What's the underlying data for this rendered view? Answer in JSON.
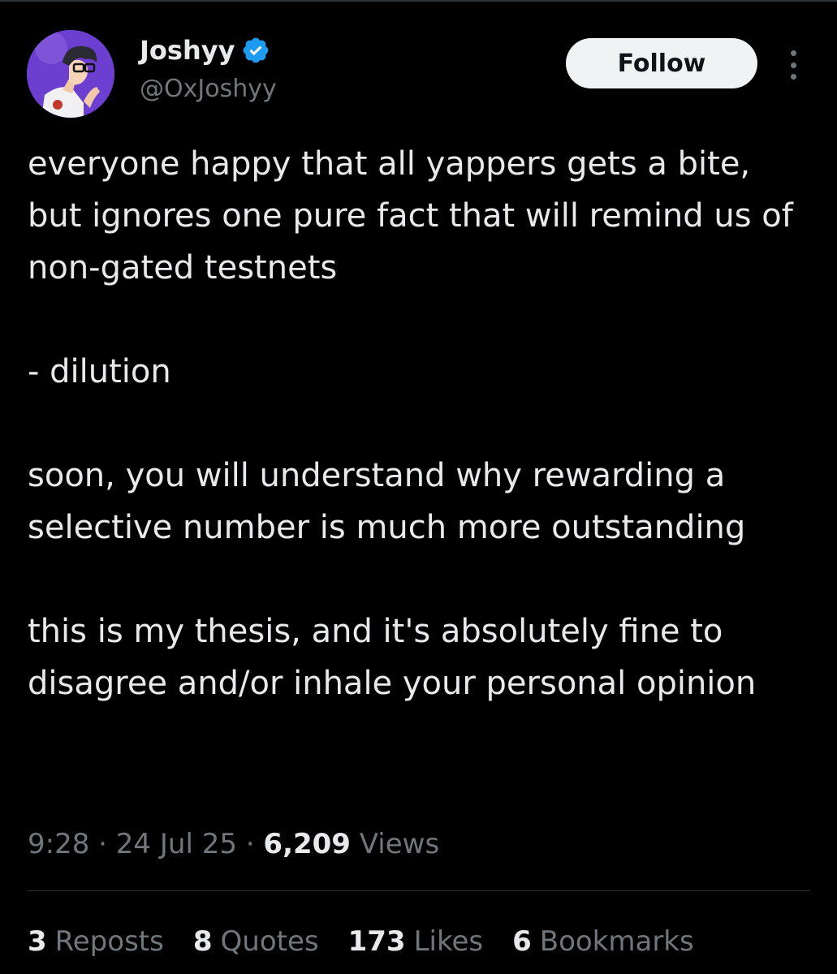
{
  "author": {
    "display_name": "Joshyy",
    "handle": "@OxJoshyy",
    "verified": true,
    "avatar_icon": "anime-avatar",
    "avatar_bg": "#6c3fd0"
  },
  "actions": {
    "follow_label": "Follow",
    "more_icon": "more-vertical-icon"
  },
  "tweet": {
    "paragraphs": [
      "everyone happy that all yappers gets a bite, but ignores one pure fact that will remind us of non-gated testnets",
      "- dilution",
      "soon, you will understand why rewarding a selective number is much more outstanding",
      "this is my thesis, and it's absolutely fine to disagree and/or inhale your personal opinion"
    ]
  },
  "meta": {
    "time": "9:28",
    "date": "24 Jul 25",
    "separator": "·",
    "views_count": "6,209",
    "views_label": "Views"
  },
  "stats": {
    "reposts_count": "3",
    "reposts_label": "Reposts",
    "quotes_count": "8",
    "quotes_label": "Quotes",
    "likes_count": "173",
    "likes_label": "Likes",
    "bookmarks_count": "6",
    "bookmarks_label": "Bookmarks"
  },
  "colors": {
    "background": "#000000",
    "text_primary": "#e7e9ea",
    "text_secondary": "#71767b",
    "verified_blue": "#1d9bf0",
    "follow_bg": "#eff3f4",
    "divider": "#2f3336"
  }
}
